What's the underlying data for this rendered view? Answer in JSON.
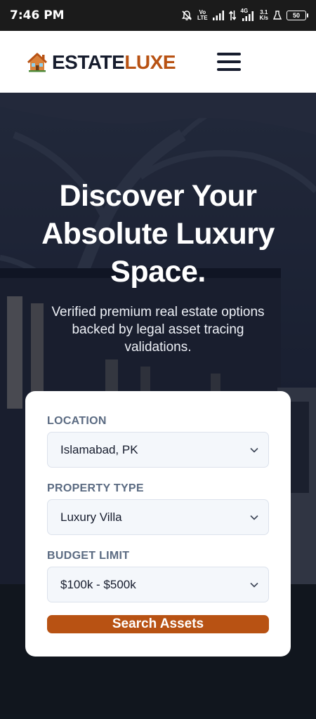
{
  "status_bar": {
    "time": "7:46 PM",
    "volte_top": "Vo",
    "volte_bottom": "LTE",
    "network_type": "4G",
    "speed_value": "3.1",
    "speed_unit": "K/s",
    "battery": "50",
    "icons": [
      "bell-off-icon",
      "signal-icon",
      "data-transfer-icon",
      "signal-4g-icon",
      "lab-flask-icon",
      "battery-icon"
    ]
  },
  "header": {
    "logo_part1": "ESTATE",
    "logo_part2": "LUXE",
    "logo_icon": "house-icon",
    "menu_icon": "hamburger-menu-icon"
  },
  "hero": {
    "title_line1": "Discover Your",
    "title_line2": "Absolute Luxury",
    "title_line3": "Space.",
    "subtitle_line1": "Verified premium real estate options",
    "subtitle_line2": "backed by legal asset tracing",
    "subtitle_line3": "validations."
  },
  "search": {
    "location_label": "LOCATION",
    "location_value": "Islamabad, PK",
    "property_type_label": "PROPERTY TYPE",
    "property_type_value": "Luxury Villa",
    "budget_label": "BUDGET LIMIT",
    "budget_value": "$100k - $500k",
    "button_label": "Search Assets"
  },
  "colors": {
    "brand_orange": "#b85213",
    "brand_navy": "#161c2d",
    "label_gray": "#5b6b82"
  }
}
